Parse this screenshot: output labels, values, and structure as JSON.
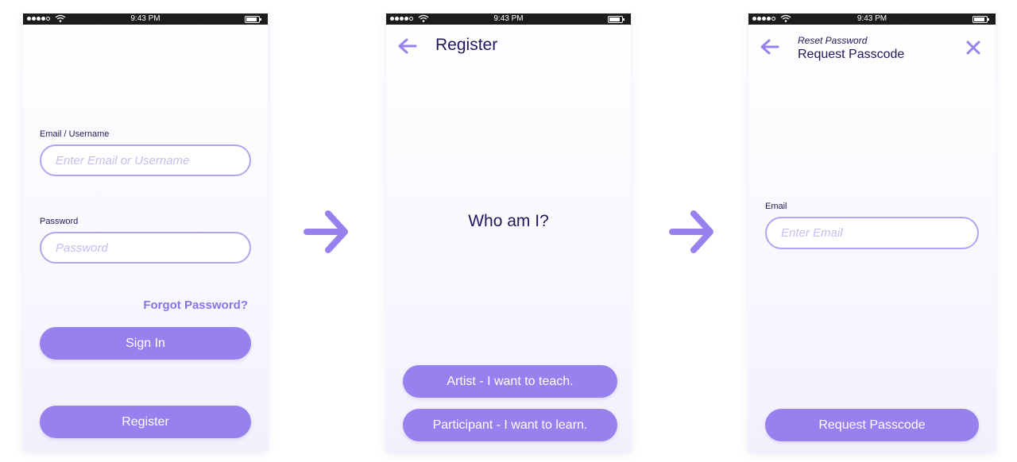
{
  "status_bar": {
    "time": "9:43 PM"
  },
  "login": {
    "email_label": "Email / Username",
    "email_placeholder": "Enter Email or Username",
    "password_label": "Password",
    "password_placeholder": "Password",
    "forgot_password": "Forgot Password?",
    "sign_in": "Sign In",
    "register": "Register"
  },
  "register_screen": {
    "title": "Register",
    "question": "Who am I?",
    "artist_button": "Artist - I want to teach.",
    "participant_button": "Participant - I want to learn."
  },
  "reset_screen": {
    "subtitle": "Reset Password",
    "title": "Request Passcode",
    "email_label": "Email",
    "email_placeholder": "Enter Email",
    "request_button": "Request Passcode"
  },
  "colors": {
    "accent": "#9781ef",
    "accent_light": "#b3a4f0",
    "text_dark": "#22175a",
    "status_bar": "#1c1c1c"
  },
  "icons": {
    "back": "arrow-left-icon",
    "close": "close-icon",
    "flow": "arrow-right-icon"
  }
}
